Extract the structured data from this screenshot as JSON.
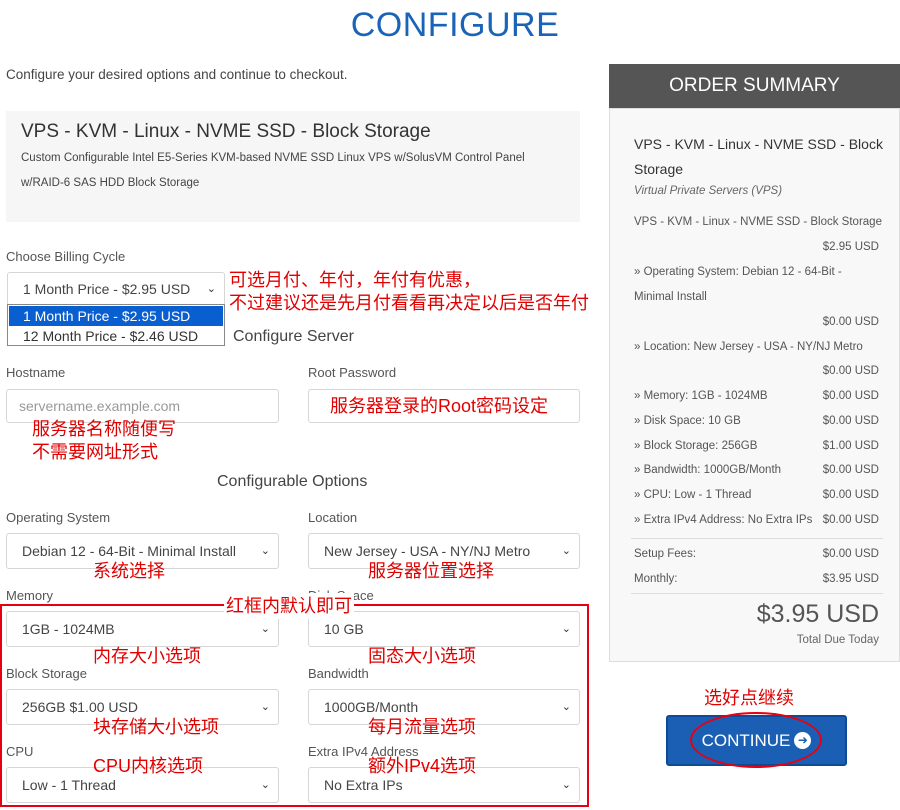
{
  "page": {
    "title": "CONFIGURE",
    "intro": "Configure your desired options and continue to checkout."
  },
  "product": {
    "name": "VPS - KVM - Linux - NVME SSD - Block Storage",
    "desc_line1": "Custom Configurable Intel E5-Series KVM-based NVME SSD Linux VPS w/SolusVM Control Panel",
    "desc_line2": "w/RAID-6 SAS HDD Block Storage"
  },
  "billing": {
    "label": "Choose Billing Cycle",
    "selected": "1 Month Price - $2.95 USD",
    "options": [
      "1 Month Price - $2.95 USD",
      "12 Month Price - $2.46 USD"
    ]
  },
  "configure_server": {
    "heading": "Configure Server",
    "hostname_label": "Hostname",
    "hostname_placeholder": "servername.example.com",
    "root_password_label": "Root Password"
  },
  "options": {
    "heading": "Configurable Options",
    "os_label": "Operating System",
    "os_value": "Debian 12 - 64-Bit - Minimal Install",
    "location_label": "Location",
    "location_value": "New Jersey - USA - NY/NJ Metro",
    "memory_label": "Memory",
    "memory_value": "1GB - 1024MB",
    "disk_label": "Disk Space",
    "disk_value": "10 GB",
    "block_label": "Block Storage",
    "block_value": "256GB $1.00 USD",
    "bandwidth_label": "Bandwidth",
    "bandwidth_value": "1000GB/Month",
    "cpu_label": "CPU",
    "cpu_value": "Low - 1 Thread",
    "ipv4_label": "Extra IPv4 Address",
    "ipv4_value": "No Extra IPs"
  },
  "annotations": {
    "billing_note1": "可选月付、年付，年付有优惠，",
    "billing_note2": "不过建议还是先月付看看再决定以后是否年付",
    "root_note": "服务器登录的Root密码设定",
    "hostname_note1": "服务器名称随便写",
    "hostname_note2": "不需要网址形式",
    "os_note": "系统选择",
    "location_note": "服务器位置选择",
    "redbox_note": "红框内默认即可",
    "memory_note": "内存大小选项",
    "disk_note": "固态大小选项",
    "block_note": "块存储大小选项",
    "bandwidth_note": "每月流量选项",
    "cpu_note": "CPU内核选项",
    "ipv4_note": "额外IPv4选项",
    "continue_note": "选好点继续",
    "accent_color": "#e00000"
  },
  "summary": {
    "heading": "ORDER SUMMARY",
    "product_name": "VPS - KVM - Linux - NVME SSD - Block Storage",
    "group": "Virtual Private Servers (VPS)",
    "base_item": "VPS - KVM - Linux - NVME SSD - Block Storage",
    "base_price": "$2.95 USD",
    "items": [
      {
        "label": "» Operating System: Debian 12 - 64-Bit -",
        "label2": "Minimal Install",
        "price": "$0.00 USD"
      },
      {
        "label": "» Location: New Jersey - USA - NY/NJ Metro",
        "price": "$0.00 USD"
      },
      {
        "label": "» Memory: 1GB - 1024MB",
        "price": "$0.00 USD"
      },
      {
        "label": "» Disk Space: 10 GB",
        "price": "$0.00 USD"
      },
      {
        "label": "» Block Storage: 256GB",
        "price": "$1.00 USD"
      },
      {
        "label": "» Bandwidth: 1000GB/Month",
        "price": "$0.00 USD"
      },
      {
        "label": "» CPU: Low - 1 Thread",
        "price": "$0.00 USD"
      },
      {
        "label": "» Extra IPv4 Address: No Extra IPs",
        "price": "$0.00 USD"
      }
    ],
    "setup_label": "Setup Fees:",
    "setup_price": "$0.00 USD",
    "monthly_label": "Monthly:",
    "monthly_price": "$3.95 USD",
    "total": "$3.95 USD",
    "total_label": "Total Due Today"
  },
  "cta": {
    "continue_label": "CONTINUE",
    "brand_color": "#1a5fb4"
  }
}
